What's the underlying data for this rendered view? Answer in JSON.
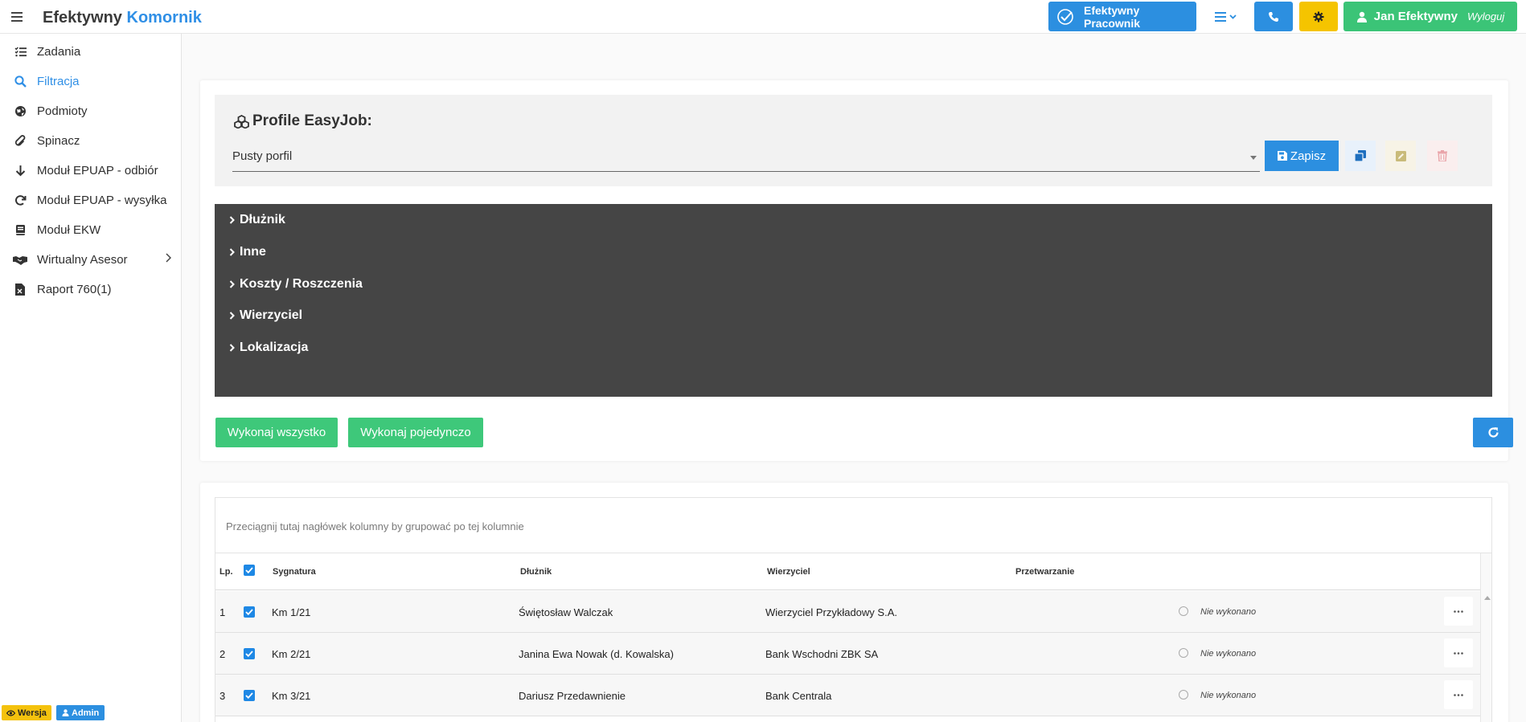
{
  "header": {
    "brand_main": "Efektywny",
    "brand_accent": "Komornik",
    "pracownik_label": "Efektywny Pracownik",
    "user_name": "Jan Efektywny",
    "logout_label": "Wyloguj"
  },
  "sidebar": {
    "items": [
      {
        "label": "Zadania",
        "icon": "tasks-icon"
      },
      {
        "label": "Filtracja",
        "icon": "search-icon"
      },
      {
        "label": "Podmioty",
        "icon": "globe-icon"
      },
      {
        "label": "Spinacz",
        "icon": "paperclip-icon"
      },
      {
        "label": "Moduł EPUAP - odbiór",
        "icon": "arrow-down-icon"
      },
      {
        "label": "Moduł EPUAP - wysyłka",
        "icon": "redo-icon"
      },
      {
        "label": "Moduł EKW",
        "icon": "book-icon"
      },
      {
        "label": "Wirtualny Asesor",
        "icon": "handshake-icon"
      },
      {
        "label": "Raport 760(1)",
        "icon": "excel-file-icon"
      }
    ],
    "version_label": "Wersja",
    "admin_label": "Admin"
  },
  "profile": {
    "title": "Profile EasyJob:",
    "selected": "Pusty porfil",
    "save_label": "Zapisz"
  },
  "filters": [
    "Dłużnik",
    "Inne",
    "Koszty / Roszczenia",
    "Wierzyciel",
    "Lokalizacja"
  ],
  "actions": {
    "run_all": "Wykonaj wszystko",
    "run_single": "Wykonaj pojedynczo"
  },
  "grid": {
    "group_hint": "Przeciągnij tutaj nagłówek kolumny by grupować po tej kolumnie",
    "columns": {
      "lp": "Lp.",
      "sygnatura": "Sygnatura",
      "dluznik": "Dłużnik",
      "wierzyciel": "Wierzyciel",
      "przetwarzanie": "Przetwarzanie"
    },
    "rows": [
      {
        "lp": "1",
        "sygnatura": "Km 1/21",
        "dluznik": "Świętosław Walczak",
        "wierzyciel": "Wierzyciel Przykładowy S.A.",
        "status": "Nie wykonano"
      },
      {
        "lp": "2",
        "sygnatura": "Km 2/21",
        "dluznik": "Janina Ewa Nowak (d. Kowalska)",
        "wierzyciel": "Bank Wschodni ZBK SA",
        "status": "Nie wykonano"
      },
      {
        "lp": "3",
        "sygnatura": "Km 3/21",
        "dluznik": "Dariusz Przedawnienie",
        "wierzyciel": "Bank Centrala",
        "status": "Nie wykonano"
      }
    ]
  },
  "colors": {
    "primary": "#2c8fe0",
    "success": "#3ec87a",
    "warning": "#f5c400",
    "dark_panel": "#454545"
  }
}
